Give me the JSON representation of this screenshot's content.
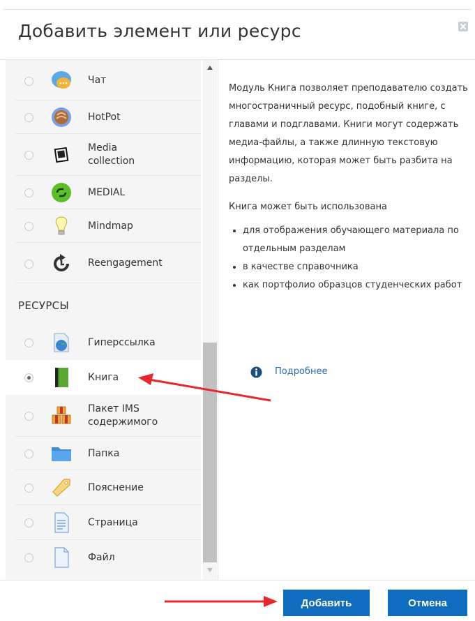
{
  "dialog": {
    "title": "Добавить элемент или ресурс",
    "close_icon": "close-icon"
  },
  "list": {
    "activities": [
      {
        "label": "Чат",
        "icon": "chat-icon"
      },
      {
        "label": "HotPot",
        "icon": "hotpot-icon"
      },
      {
        "label": "Media\ncollection",
        "icon": "media-collection-icon"
      },
      {
        "label": "MEDIAL",
        "icon": "medial-icon"
      },
      {
        "label": "Mindmap",
        "icon": "mindmap-icon"
      },
      {
        "label": "Reengagement",
        "icon": "reengagement-icon"
      }
    ],
    "resources_heading": "РЕСУРСЫ",
    "resources": [
      {
        "label": "Гиперссылка",
        "icon": "url-icon"
      },
      {
        "label": "Книга",
        "icon": "book-icon",
        "selected": true
      },
      {
        "label": "Пакет IMS\nсодержимого",
        "icon": "ims-package-icon"
      },
      {
        "label": "Папка",
        "icon": "folder-icon"
      },
      {
        "label": "Пояснение",
        "icon": "label-icon"
      },
      {
        "label": "Страница",
        "icon": "page-icon"
      },
      {
        "label": "Файл",
        "icon": "file-icon"
      }
    ]
  },
  "description": {
    "paragraph1": "Модуль Книга позволяет преподавателю создать многостраничный ресурс, подобный книге, с главами и подглавами. Книги могут содержать медиа-файлы, а также длинную текстовую информацию, которая может быть разбита на разделы.",
    "paragraph2": "Книга может быть использована",
    "bullets": [
      "для отображения обучающего материала по отдельным разделам",
      "в качестве справочника",
      "как портфолио образцов студенческих работ"
    ],
    "more_link": "Подробнее"
  },
  "footer": {
    "add_label": "Добавить",
    "cancel_label": "Отмена"
  },
  "colors": {
    "primary": "#0f6cbf",
    "annotation_arrow": "#e8262b"
  }
}
